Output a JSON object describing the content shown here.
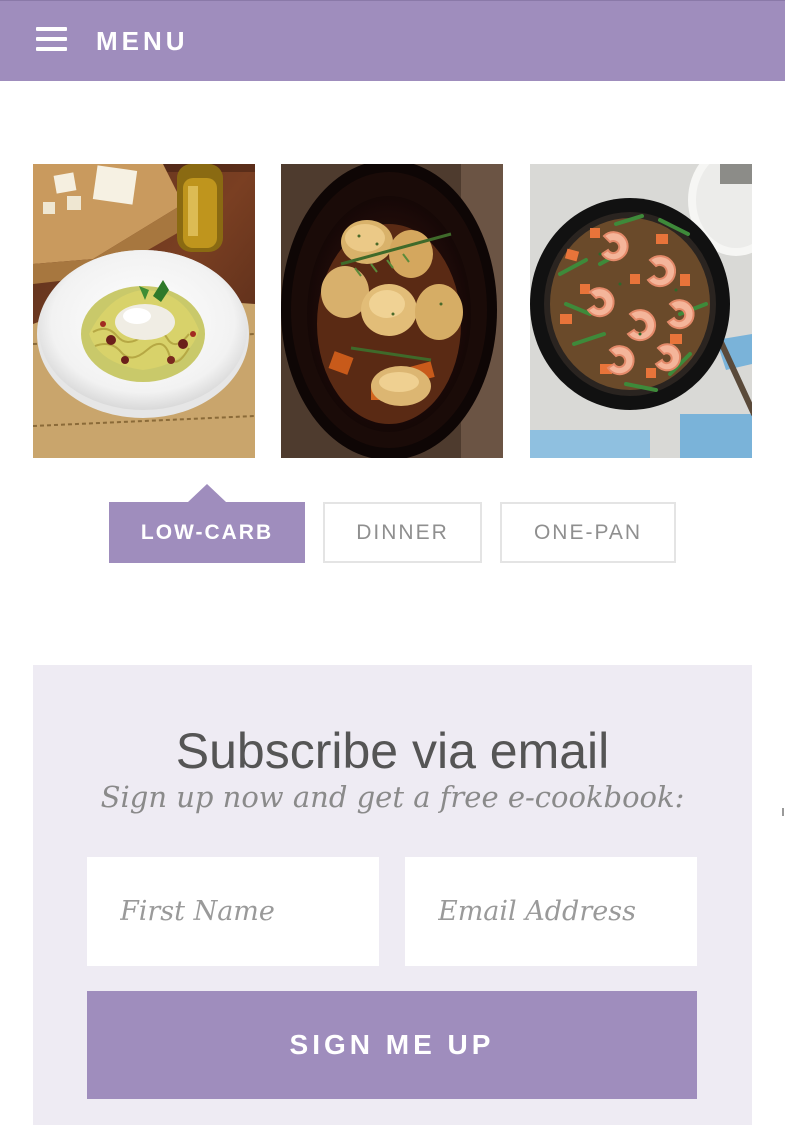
{
  "header": {
    "menu_label": "MENU",
    "menu_icon": "hamburger-icon",
    "bar_color": "#9f8dbd"
  },
  "photos": [
    {
      "subject": "spaghetti squash pasta bowl"
    },
    {
      "subject": "slow cooker chicken thighs"
    },
    {
      "subject": "shrimp skillet with green beans"
    }
  ],
  "tabs": [
    {
      "label": "LOW-CARB",
      "active": true
    },
    {
      "label": "DINNER",
      "active": false
    },
    {
      "label": "ONE-PAN",
      "active": false
    }
  ],
  "subscribe": {
    "title": "Subscribe via email",
    "subtitle": "Sign up now and get a free e-cookbook:",
    "first_name_placeholder": "First Name",
    "email_placeholder": "Email Address",
    "button_label": "SIGN ME UP",
    "accent_color": "#9f8dbd",
    "background_color": "#eeebf3"
  }
}
